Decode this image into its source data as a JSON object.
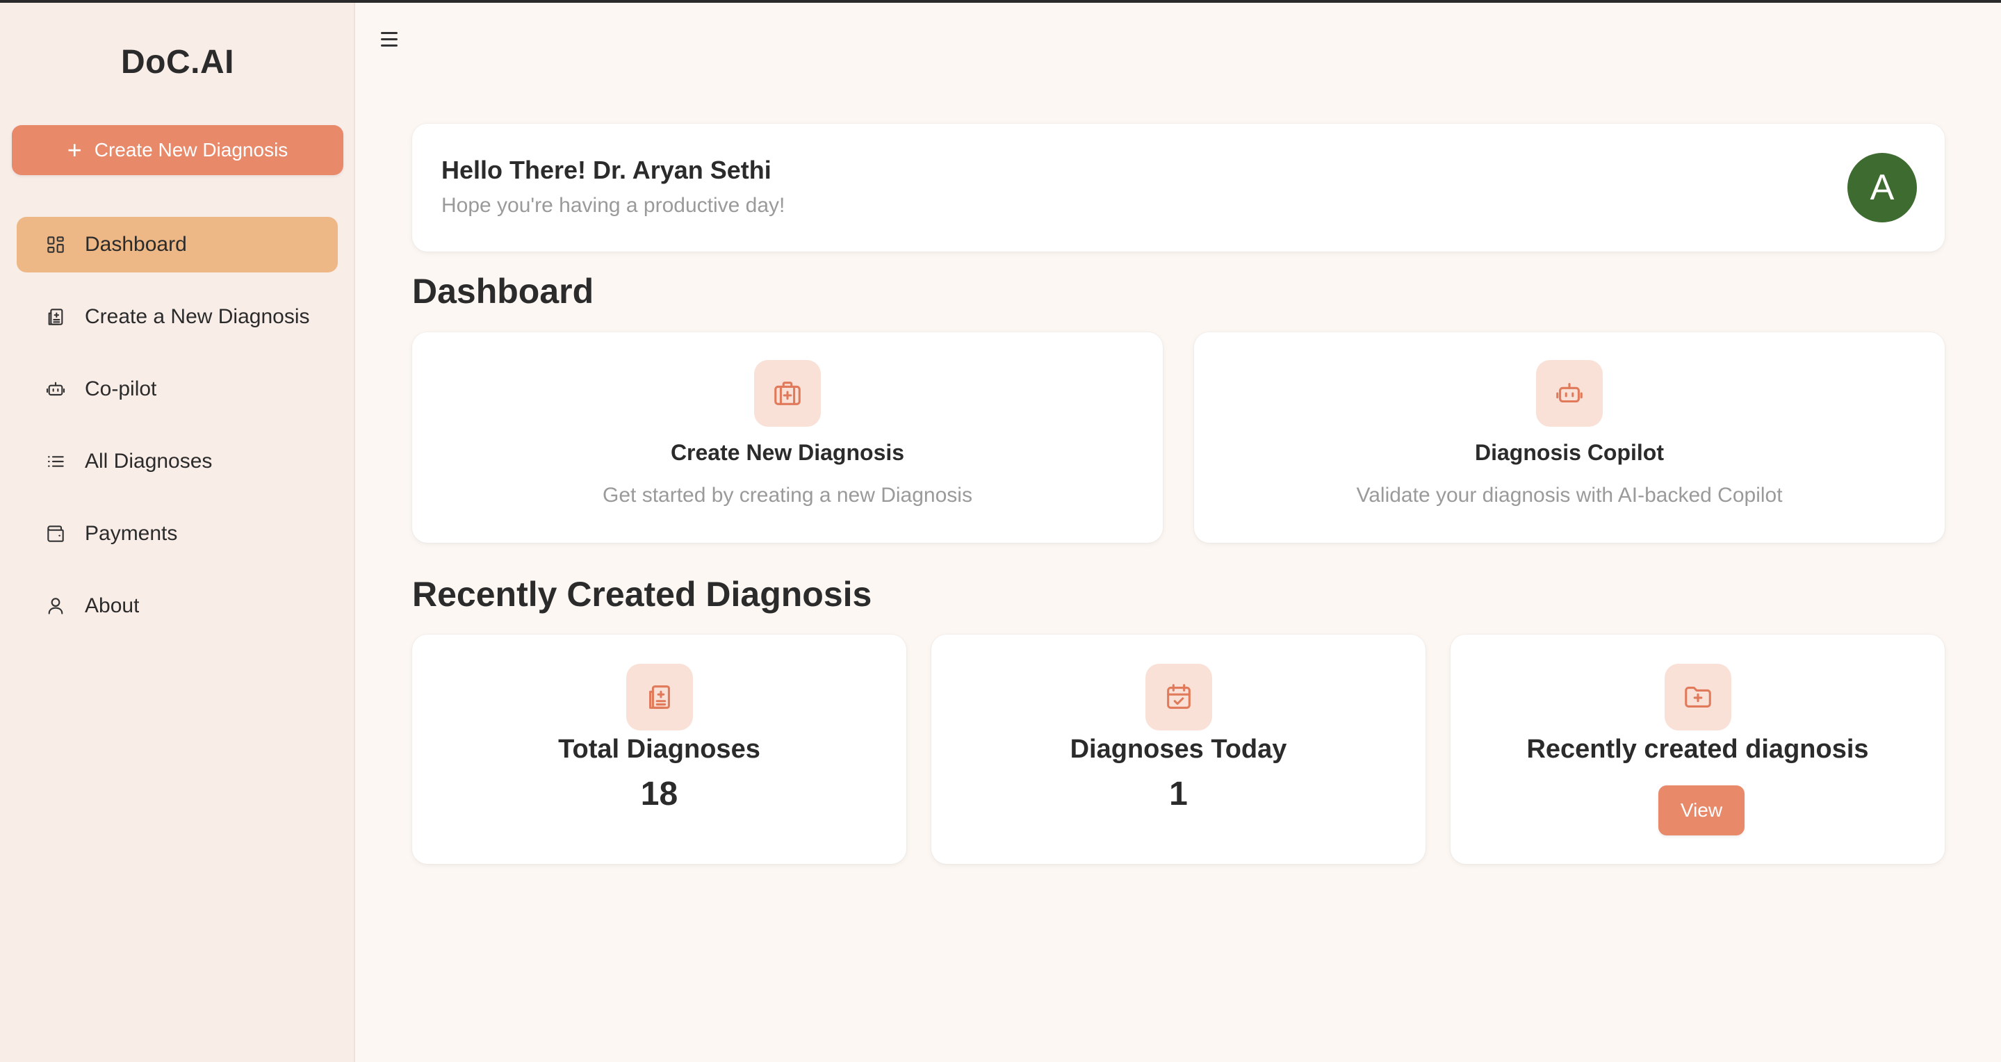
{
  "app": {
    "brand": "DoC.AI"
  },
  "sidebar": {
    "create_button": {
      "label": "Create New Diagnosis",
      "icon": "plus-icon"
    },
    "items": [
      {
        "label": "Dashboard",
        "icon": "dashboard-grid-icon",
        "active": true
      },
      {
        "label": "Create a New Diagnosis",
        "icon": "clipboard-medical-icon",
        "active": false
      },
      {
        "label": "Co-pilot",
        "icon": "robot-icon",
        "active": false
      },
      {
        "label": "All Diagnoses",
        "icon": "list-icon",
        "active": false
      },
      {
        "label": "Payments",
        "icon": "wallet-icon",
        "active": false
      },
      {
        "label": "About",
        "icon": "user-icon",
        "active": false
      }
    ]
  },
  "header": {
    "menu_icon": "hamburger-menu-icon",
    "greeting": "Hello There! Dr. Aryan Sethi",
    "subtitle": "Hope you're having a productive day!",
    "avatar_initial": "A"
  },
  "dashboard": {
    "title": "Dashboard",
    "cards": [
      {
        "title": "Create New Diagnosis",
        "subtitle": "Get started by creating a new Diagnosis",
        "icon": "medical-kit-icon"
      },
      {
        "title": "Diagnosis Copilot",
        "subtitle": "Validate your diagnosis with AI-backed Copilot",
        "icon": "robot-icon"
      }
    ]
  },
  "recent": {
    "title": "Recently Created Diagnosis",
    "stats": [
      {
        "title": "Total Diagnoses",
        "value": "18",
        "icon": "clipboard-medical-icon"
      },
      {
        "title": "Diagnoses Today",
        "value": "1",
        "icon": "calendar-check-icon"
      },
      {
        "title": "Recently created diagnosis",
        "button_label": "View",
        "icon": "folder-plus-icon"
      }
    ]
  },
  "colors": {
    "accent": "#e8896a",
    "active_nav": "#edb885",
    "sidebar_bg": "#f9ede8",
    "page_bg": "#fcf7f3",
    "icon_tint": "#f9e1d7",
    "avatar_bg": "#3e6b2f"
  }
}
